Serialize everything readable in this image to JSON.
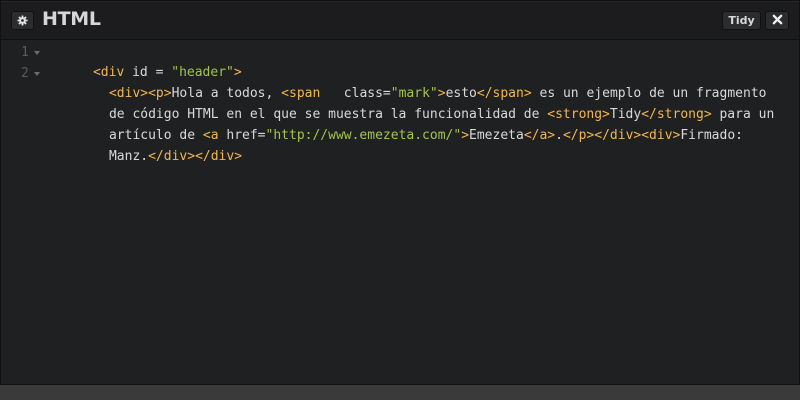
{
  "header": {
    "title": "HTML",
    "settings_icon": "gear-icon",
    "tidy_label": "Tidy",
    "close_icon": "close-icon"
  },
  "colors": {
    "tag": "#f3b651",
    "string": "#a6c34a",
    "text": "#d9d9d9",
    "line_number": "#5a5b5e",
    "background": "#1f2022"
  },
  "gutter": {
    "line_numbers": [
      "1",
      "2"
    ]
  },
  "code": {
    "line1": {
      "t1": "<div",
      "t2": " id = ",
      "t3": "\"header\"",
      "t4": ">"
    },
    "line2a": {
      "t1": "<div><p>",
      "t2": "Hola a todos, ",
      "t3": "<span",
      "t4": "   class=",
      "t5": "\"mark\"",
      "t6": ">",
      "t7": "esto",
      "t8": "</span>",
      "t9": " es un ejemplo de un fragmento"
    },
    "line2b": {
      "t1": "de código HTML en el que se muestra la funcionalidad de ",
      "t2": "<strong>",
      "t3": "Tidy",
      "t4": "</strong>",
      "t5": " para un"
    },
    "line2c": {
      "t1": "artículo de ",
      "t2": "<a",
      "t3": " href=",
      "t4": "\"http://www.emezeta.com/\"",
      "t5": ">",
      "t6": "Emezeta",
      "t7": "</a>",
      "t8": ".",
      "t9": "</p></div><div>",
      "t10": "Firmado:"
    },
    "line2d": {
      "t1": "Manz.",
      "t2": "</div></div>"
    }
  }
}
